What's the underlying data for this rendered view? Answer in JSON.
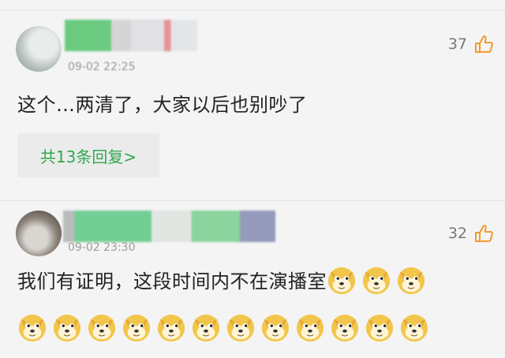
{
  "comments": [
    {
      "time": "09-02 22:25",
      "likes": "37",
      "text": "这个…两清了，大家以后也别吵了",
      "reply_label": "共13条回复>"
    },
    {
      "time": "09-02 23:30",
      "likes": "32",
      "text": "我们有证明，这段时间内不在演播室",
      "emoji": "doge-emoji",
      "emoji_count": 15
    }
  ],
  "colors": {
    "accent_green": "#2fa84f",
    "background": "#f4f4f4",
    "like_orange": "#f39a2b"
  },
  "icons": [
    "thumbs-up-icon",
    "doge-emoji"
  ]
}
